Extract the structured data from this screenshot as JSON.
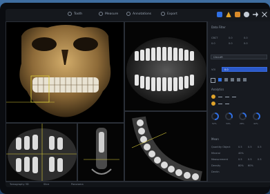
{
  "header": {
    "tabs": [
      {
        "label": "Tooth",
        "icon": "tooth-icon"
      },
      {
        "label": "Measure",
        "icon": "ruler-icon"
      },
      {
        "label": "Annotations",
        "icon": "annotation-icon"
      },
      {
        "label": "Export",
        "icon": "export-icon"
      }
    ],
    "toolbar_icons": [
      "grid-icon",
      "warning-icon",
      "folder-icon",
      "settings-icon",
      "share-icon",
      "close-icon"
    ]
  },
  "sidebar": {
    "section1_title": "Data Filter",
    "values_row1": [
      "CBCT",
      "0.0",
      "0.0"
    ],
    "values_row2": [
      "0.0",
      "0.0",
      "0.0"
    ],
    "dropdown1": "CALLAR",
    "dropdown2_label": "VOI",
    "dropdown2_value": "0.0",
    "section2_title": "Analytics",
    "gauges": [
      "52%",
      "34%",
      "28%",
      "42%"
    ],
    "section3_title": "Mean",
    "details": [
      [
        "Quantity Object",
        "0.5",
        "0.5",
        "0.5"
      ],
      [
        "Mineral",
        "40%",
        "",
        ""
      ],
      [
        "Measurement",
        "0.5",
        "0.5",
        "0.5"
      ],
      [
        "Density",
        "80%",
        "60%",
        ""
      ],
      [
        "Dentin",
        "",
        "",
        ""
      ]
    ]
  },
  "status": {
    "items": [
      "Tomography 3D",
      "Slice",
      "Panorama"
    ]
  },
  "colors": {
    "accent": "#2f6fe4",
    "bone": "#b39057",
    "enamel": "#e8e2d2",
    "crosshair": "#e0d23a"
  }
}
